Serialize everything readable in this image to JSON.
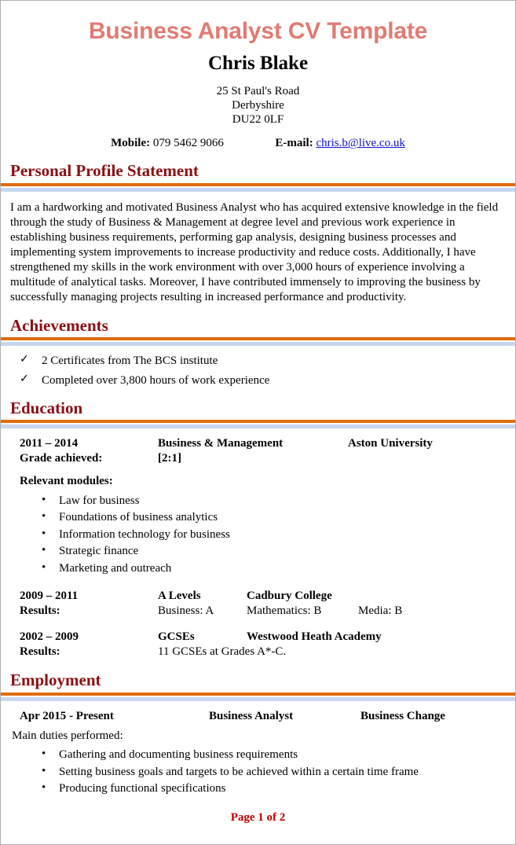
{
  "document": {
    "title": "Business Analyst CV Template",
    "name": "Chris Blake",
    "address": {
      "line1": "25 St Paul's Road",
      "line2": "Derbyshire",
      "line3": "DU22 0LF"
    },
    "contact": {
      "mobile_label": "Mobile:",
      "mobile_value": "079 5462 9066",
      "email_label": "E-mail:",
      "email_value": "chris.b@live.co.uk"
    },
    "footer": "Page 1 of 2"
  },
  "colors": {
    "title": "#E07B72",
    "section_heading": "#8B0F12",
    "rule_orange": "#E06C0B",
    "rule_blue": "#C7D7EF",
    "link": "#1111CC",
    "footer": "#C00000"
  },
  "icons": {
    "check": "✓",
    "bullet": "•"
  },
  "sections": {
    "personal_profile": {
      "heading": "Personal Profile Statement",
      "paragraph": "I am a hardworking and motivated Business Analyst who has acquired extensive knowledge in the field through the study of Business & Management at degree level and previous work experience in establishing business requirements, performing gap analysis, designing business processes and implementing system improvements to increase productivity and reduce costs. Additionally, I have strengthened my skills in the work environment with over 3,000 hours of experience involving a multitude of analytical tasks. Moreover, I have contributed immensely to improving the business by successfully managing projects resulting in increased performance and productivity."
    },
    "achievements": {
      "heading": "Achievements",
      "items": [
        "2 Certificates from The BCS institute",
        "Completed over 3,800 hours of work experience"
      ]
    },
    "education": {
      "heading": "Education",
      "entry1": {
        "dates": "2011 – 2014",
        "subject": "Business & Management",
        "institution": "Aston University",
        "grade_label": "Grade achieved:",
        "grade_value": "[2:1]",
        "modules_label": "Relevant modules:",
        "modules": [
          "Law for business",
          "Foundations of business analytics",
          "Information technology for business",
          "Strategic finance",
          "Marketing and outreach"
        ]
      },
      "entry2": {
        "dates": "2009 – 2011",
        "qualification": "A Levels",
        "institution": "Cadbury College",
        "results_label": "Results:",
        "result1": "Business: A",
        "result2": "Mathematics: B",
        "result3": "Media: B"
      },
      "entry3": {
        "dates": "2002 – 2009",
        "qualification": "GCSEs",
        "institution": "Westwood Heath Academy",
        "results_label": "Results:",
        "result1": "11 GCSEs at Grades A*-C."
      }
    },
    "employment": {
      "heading": "Employment",
      "entry1": {
        "dates": "Apr 2015 - Present",
        "job_title": "Business Analyst",
        "department": "Business Change",
        "duties_label": "Main duties performed:",
        "duties": [
          "Gathering and documenting business requirements",
          "Setting business goals and targets to be achieved within a certain time frame",
          "Producing functional specifications"
        ]
      }
    }
  }
}
